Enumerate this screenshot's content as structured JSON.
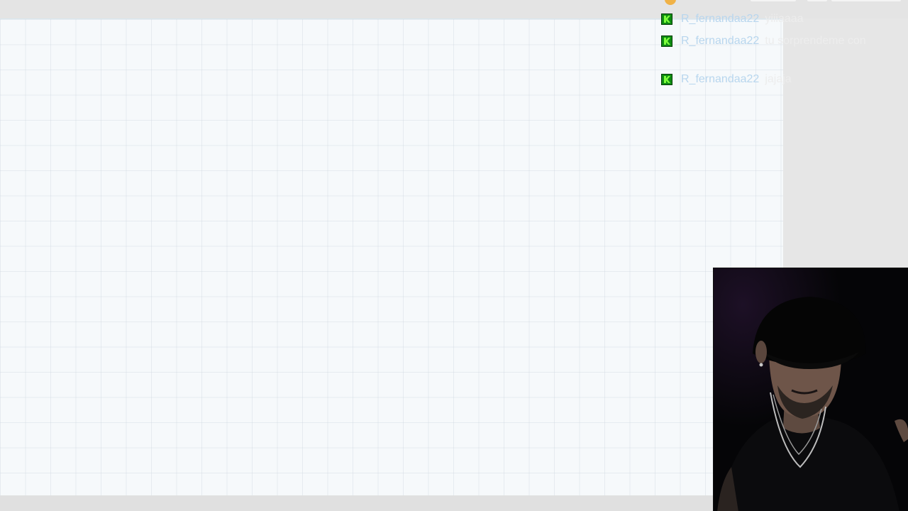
{
  "chat": {
    "messages": [
      {
        "badge_icon": "green-k-badge-icon",
        "username": "R_fernandaa22",
        "text": "yiiiaaaa"
      },
      {
        "badge_icon": "green-k-badge-icon",
        "username": "R_fernandaa22",
        "text": "tu sorprendeme con"
      },
      {
        "badge_icon": "green-k-badge-icon",
        "username": "R_fernandaa22",
        "text": "jajaja"
      }
    ]
  },
  "colors": {
    "canvas_bg": "#f6f9fb",
    "grid_line": "#d5dee6",
    "chrome_bg": "#e6e6e6",
    "badge_green": "#0e8a12",
    "badge_k": "#7cff3a",
    "username": "#b8d6ee",
    "message_text": "#ededed"
  },
  "webcam": {
    "subject": "man-with-black-cap-and-silver-chain"
  }
}
